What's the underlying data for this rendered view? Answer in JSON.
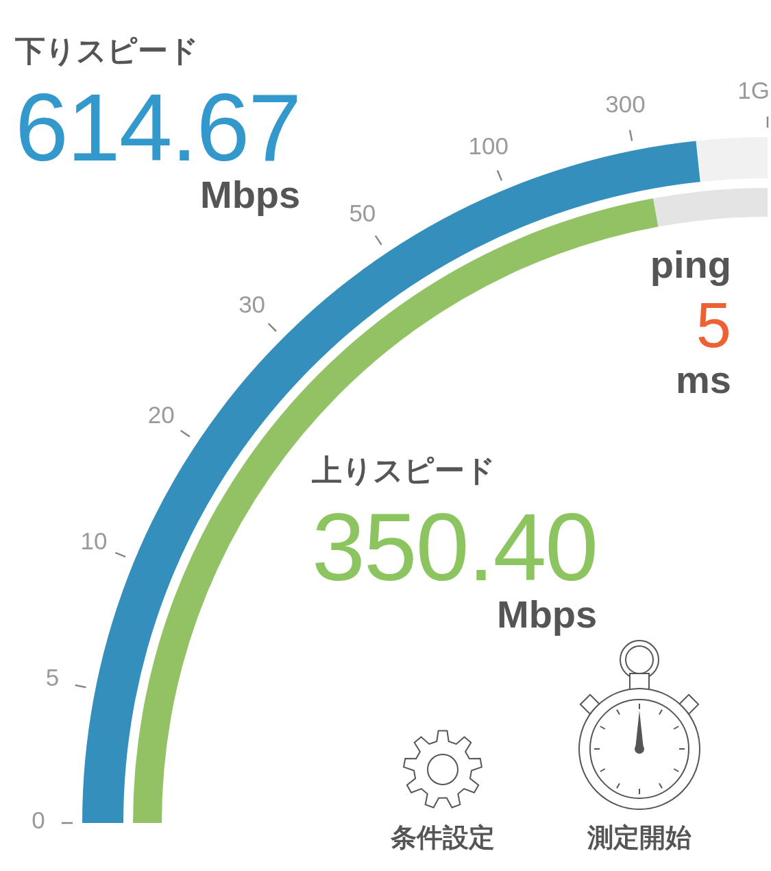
{
  "gauge": {
    "ticks": [
      "0",
      "5",
      "10",
      "20",
      "30",
      "50",
      "100",
      "300",
      "1G"
    ]
  },
  "download": {
    "title": "下りスピード",
    "value": "614.67",
    "unit": "Mbps"
  },
  "upload": {
    "title": "上りスピード",
    "value": "350.40",
    "unit": "Mbps"
  },
  "ping": {
    "title": "ping",
    "value": "5",
    "unit": "ms"
  },
  "buttons": [
    {
      "kind": "settings",
      "label": "条件設定"
    },
    {
      "kind": "start",
      "label": "測定開始"
    }
  ]
}
